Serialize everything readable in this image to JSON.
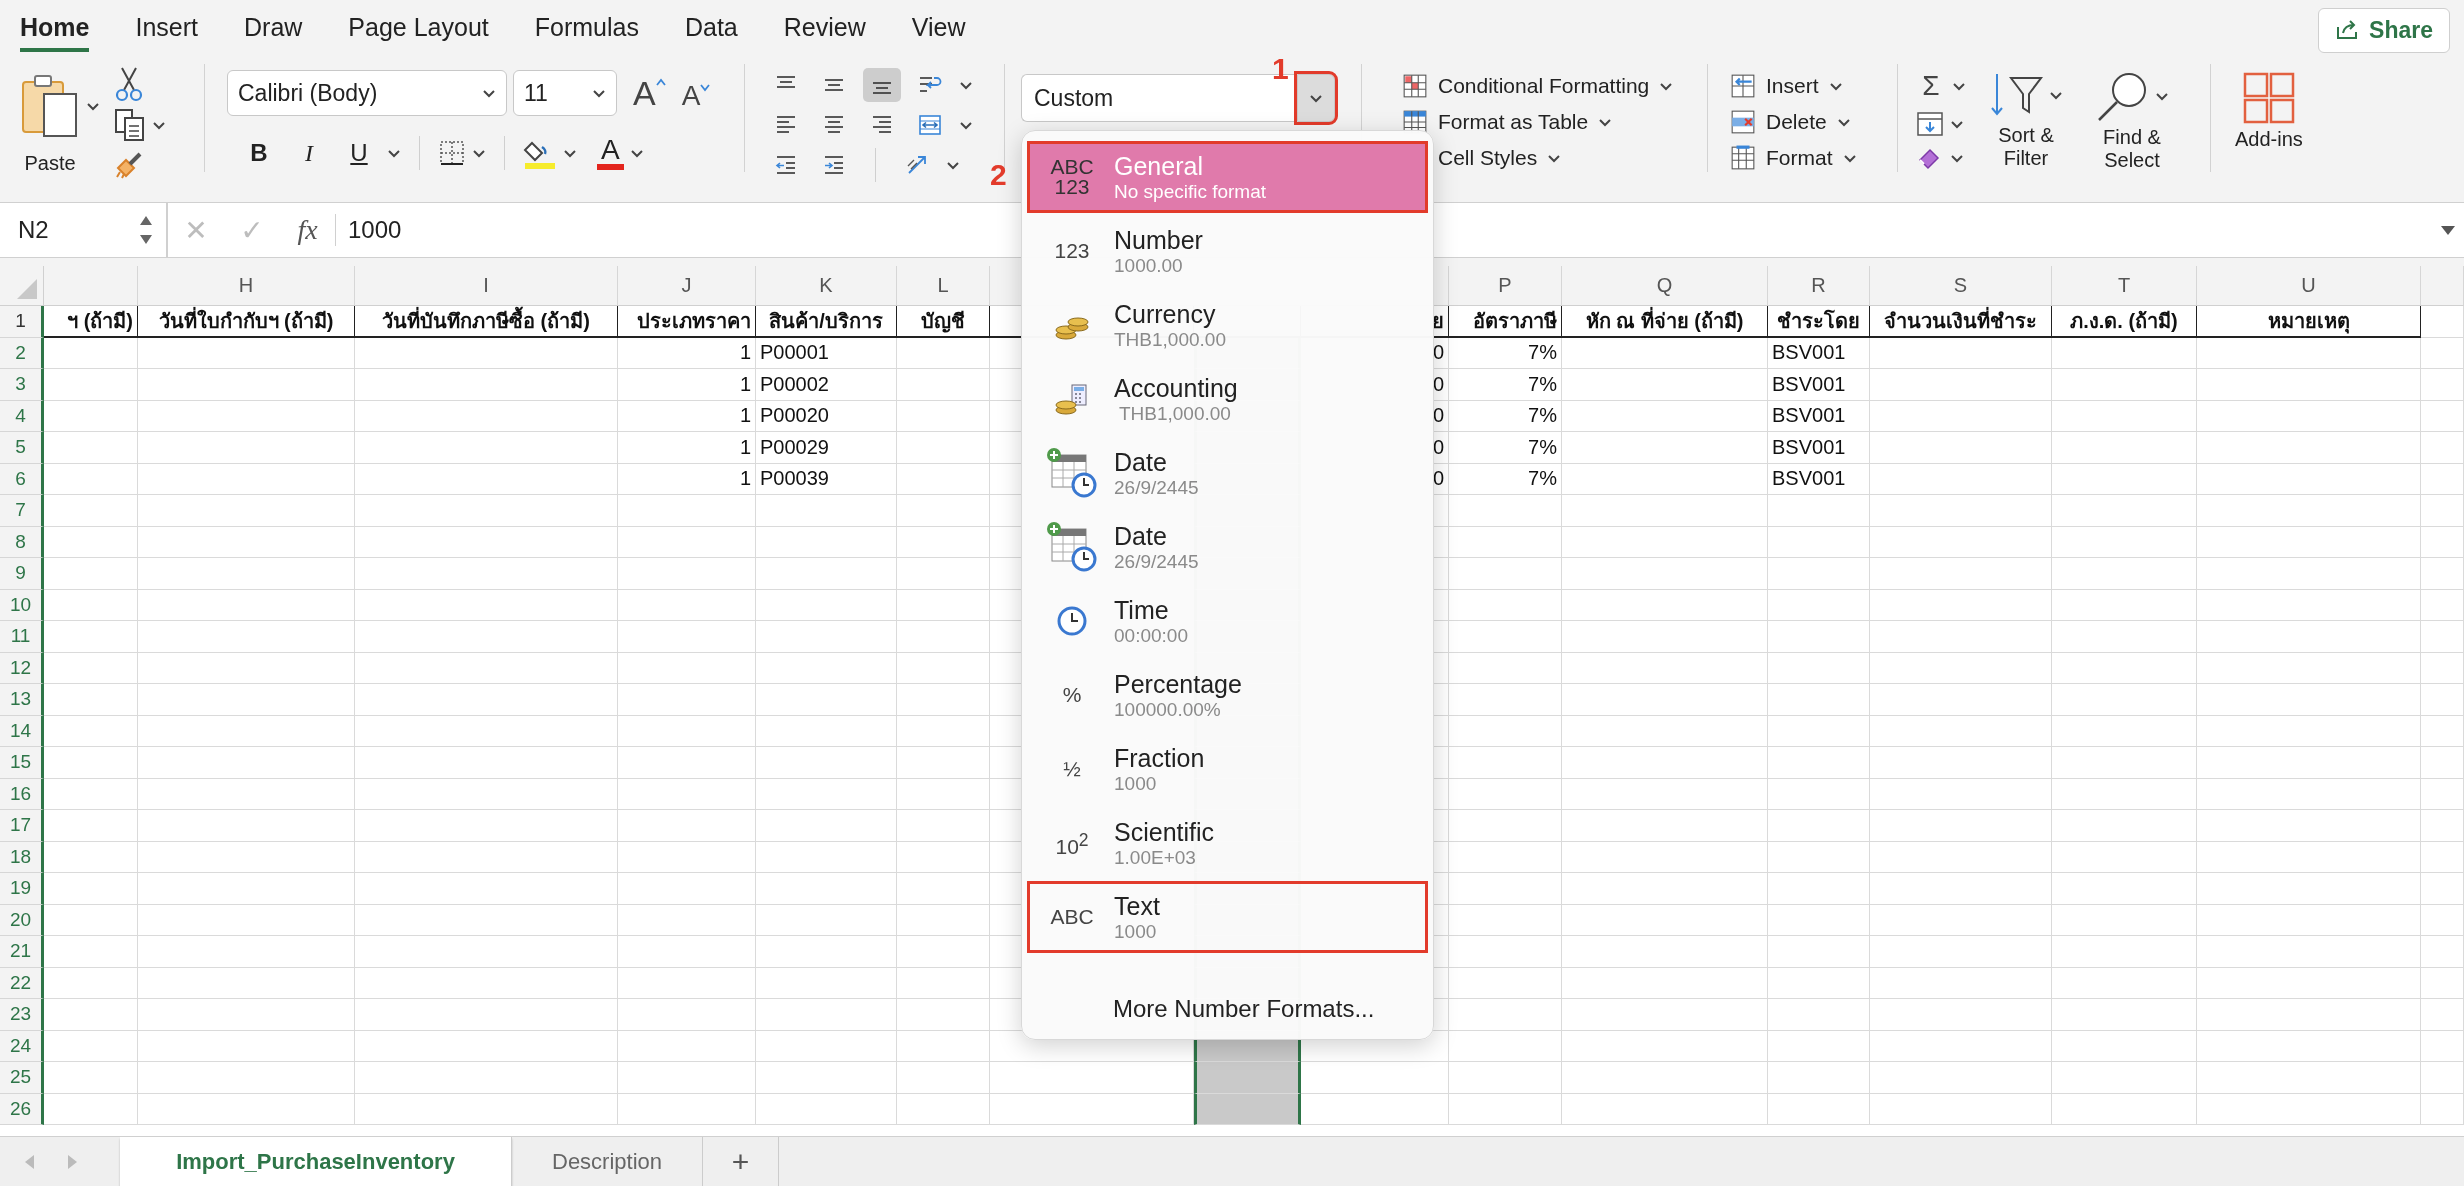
{
  "tabs": [
    {
      "label": "Home",
      "selected": true
    },
    {
      "label": "Insert",
      "selected": false
    },
    {
      "label": "Draw",
      "selected": false
    },
    {
      "label": "Page Layout",
      "selected": false
    },
    {
      "label": "Formulas",
      "selected": false
    },
    {
      "label": "Data",
      "selected": false
    },
    {
      "label": "Review",
      "selected": false
    },
    {
      "label": "View",
      "selected": false
    }
  ],
  "share": "Share",
  "ribbon": {
    "clipboard": {
      "paste": "Paste"
    },
    "font": {
      "name": "Calibri (Body)",
      "size": "11",
      "grow": "A",
      "shrink": "A",
      "bold": "B",
      "italic": "I",
      "underline": "U",
      "font_color": "A"
    },
    "alignment": [
      {
        "kind": "top",
        "selected": false
      },
      {
        "kind": "middle",
        "selected": false
      },
      {
        "kind": "bottom",
        "selected": true
      },
      {
        "kind": "wrap",
        "selected": false
      },
      {
        "kind": "left",
        "selected": false
      },
      {
        "kind": "center",
        "selected": false
      },
      {
        "kind": "right",
        "selected": false
      },
      {
        "kind": "merge",
        "selected": false
      },
      {
        "kind": "outdent",
        "selected": false
      },
      {
        "kind": "indent",
        "selected": false
      },
      {
        "kind": "orientation",
        "selected": false
      }
    ],
    "number": {
      "format": "Custom",
      "button_marked": true
    },
    "styles": [
      {
        "label": "Conditional Formatting",
        "kind": "conditional"
      },
      {
        "label": "Format as Table",
        "kind": "table"
      },
      {
        "label": "Cell Styles",
        "kind": "cell_styles"
      }
    ],
    "cells": [
      "Insert",
      "Delete",
      "Format"
    ],
    "editing": {
      "sum": "Σ",
      "sort": "Sort & Filter",
      "find": "Find & Select"
    },
    "addins": "Add-ins"
  },
  "callouts": [
    {
      "text": "1"
    },
    {
      "text": "2"
    }
  ],
  "formula_bar": {
    "cell": "N2",
    "cancel": "✕",
    "enter": "✓",
    "function": "fx",
    "value": "1000"
  },
  "sheet": {
    "columns": [
      {
        "kind": "text",
        "selected": false
      },
      {
        "header": "H",
        "kind": "text",
        "selected": false
      },
      {
        "header": "I",
        "kind": "text",
        "selected": false
      },
      {
        "header": "J",
        "kind": "number",
        "selected": false
      },
      {
        "header": "K",
        "kind": "text",
        "selected": false
      },
      {
        "header": "L",
        "kind": "text",
        "selected": false
      },
      {
        "kind": "text",
        "selected": false
      },
      {
        "kind": "text",
        "selected": true
      },
      {
        "kind": "number",
        "selected": false
      },
      {
        "header": "P",
        "kind": "number",
        "selected": false
      },
      {
        "header": "Q",
        "kind": "text",
        "selected": false
      },
      {
        "header": "R",
        "kind": "text",
        "selected": false
      },
      {
        "header": "S",
        "kind": "text",
        "selected": false
      },
      {
        "header": "T",
        "kind": "text",
        "selected": false
      },
      {
        "header": "U",
        "kind": "text",
        "selected": false
      }
    ],
    "rows": [
      {
        "number": "1",
        "kind": "heading",
        "selected": false,
        "cells": [
          "ฯ (ถ้ามี)",
          "วันที่ใบกำกับฯ (ถ้ามี)",
          "วันที่บันทึกภาษีซื้อ (ถ้ามี)",
          "ประเภทราคา",
          "สินค้า/บริการ",
          "บัญชี",
          "",
          "",
          "ย",
          "อัตราภาษี",
          "หัก ณ ที่จ่าย (ถ้ามี)",
          "ชำระโดย",
          "จำนวนเงินที่ชำระ",
          "ภ.ง.ด. (ถ้ามี)",
          "หมายเหตุ"
        ]
      },
      {
        "number": "2",
        "kind": "data",
        "selected": true,
        "cells": [
          "",
          "",
          "",
          "1",
          "P00001",
          "",
          "",
          "",
          "0",
          "7%",
          "",
          "BSV001",
          "",
          "",
          ""
        ]
      },
      {
        "number": "3",
        "kind": "data",
        "selected": true,
        "cells": [
          "",
          "",
          "",
          "1",
          "P00002",
          "",
          "",
          "",
          "0",
          "7%",
          "",
          "BSV001",
          "",
          "",
          ""
        ]
      },
      {
        "number": "4",
        "kind": "data",
        "selected": true,
        "cells": [
          "",
          "",
          "",
          "1",
          "P00020",
          "",
          "",
          "",
          "0",
          "7%",
          "",
          "BSV001",
          "",
          "",
          ""
        ]
      },
      {
        "number": "5",
        "kind": "data",
        "selected": true,
        "cells": [
          "",
          "",
          "",
          "1",
          "P00029",
          "",
          "",
          "",
          "0",
          "7%",
          "",
          "BSV001",
          "",
          "",
          ""
        ]
      },
      {
        "number": "6",
        "kind": "data",
        "selected": true,
        "cells": [
          "",
          "",
          "",
          "1",
          "P00039",
          "",
          "",
          "",
          "0",
          "7%",
          "",
          "BSV001",
          "",
          "",
          ""
        ]
      },
      {
        "number": "7",
        "kind": "data",
        "selected": true
      },
      {
        "number": "8",
        "kind": "data",
        "selected": true
      },
      {
        "number": "9",
        "kind": "data",
        "selected": true
      },
      {
        "number": "10",
        "kind": "data",
        "selected": true
      },
      {
        "number": "11",
        "kind": "data",
        "selected": true
      },
      {
        "number": "12",
        "kind": "data",
        "selected": true
      },
      {
        "number": "13",
        "kind": "data",
        "selected": true
      },
      {
        "number": "14",
        "kind": "data",
        "selected": true
      },
      {
        "number": "15",
        "kind": "data",
        "selected": true
      },
      {
        "number": "16",
        "kind": "data",
        "selected": true
      },
      {
        "number": "17",
        "kind": "data",
        "selected": true
      },
      {
        "number": "18",
        "kind": "data",
        "selected": true
      },
      {
        "number": "19",
        "kind": "data",
        "selected": true
      },
      {
        "number": "20",
        "kind": "data",
        "selected": true
      },
      {
        "number": "21",
        "kind": "data",
        "selected": true
      },
      {
        "number": "22",
        "kind": "data",
        "selected": true
      },
      {
        "number": "23",
        "kind": "data",
        "selected": true
      },
      {
        "number": "24",
        "kind": "data",
        "selected": true
      },
      {
        "number": "25",
        "kind": "data",
        "selected": true
      },
      {
        "number": "26",
        "kind": "data",
        "selected": true
      }
    ]
  },
  "number_format_menu": {
    "items": [
      {
        "kind": "glyph",
        "glyph": "ABC 123",
        "label": "General",
        "example": "No specific format",
        "selected": true,
        "marked": true
      },
      {
        "kind": "glyph",
        "glyph": "123",
        "label": "Number",
        "example": "1000.00",
        "selected": false,
        "marked": false
      },
      {
        "kind": "coins",
        "label": "Currency",
        "example": "THB1,000.00",
        "selected": false,
        "marked": false
      },
      {
        "kind": "accounting",
        "label": "Accounting",
        "example": " THB1,000.00",
        "selected": false,
        "marked": false
      },
      {
        "kind": "date",
        "label": "Date",
        "example": "26/9/2445",
        "selected": false,
        "marked": false
      },
      {
        "kind": "date",
        "label": "Date",
        "example": "26/9/2445",
        "selected": false,
        "marked": false
      },
      {
        "kind": "time",
        "label": "Time",
        "example": "00:00:00",
        "selected": false,
        "marked": false
      },
      {
        "kind": "glyph",
        "glyph": "%",
        "label": "Percentage",
        "example": "100000.00%",
        "selected": false,
        "marked": false
      },
      {
        "kind": "glyph",
        "glyph": "½",
        "label": "Fraction",
        "example": "1000",
        "selected": false,
        "marked": false
      },
      {
        "kind": "glyph",
        "glyph": "10$^{2}$",
        "label": "Scientific",
        "example": "1.00E+03",
        "selected": false,
        "marked": false
      },
      {
        "kind": "glyph",
        "glyph": "ABC",
        "label": "Text",
        "example": "1000",
        "selected": false,
        "marked": true
      }
    ],
    "more": "More Number Formats..."
  },
  "sheet_tabs": [
    {
      "label": "Import_PurchaseInventory",
      "selected": true
    },
    {
      "label": "Description",
      "selected": false
    }
  ],
  "add_sheet": "+"
}
